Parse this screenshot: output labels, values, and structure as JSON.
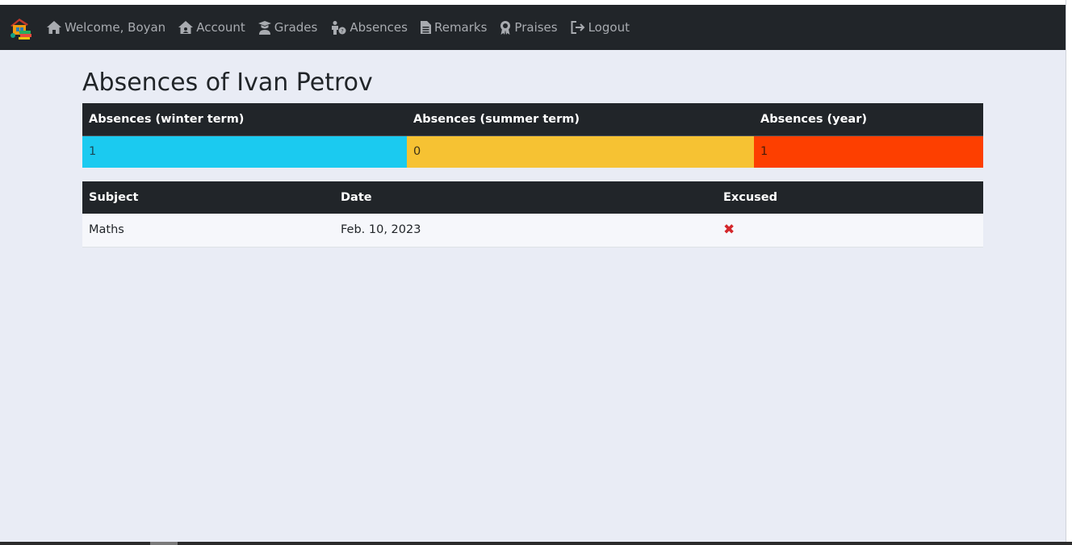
{
  "navbar": {
    "items": [
      {
        "icon": "home-icon",
        "label": "Welcome, Boyan"
      },
      {
        "icon": "account-house-icon",
        "label": "Account"
      },
      {
        "icon": "graduate-icon",
        "label": "Grades"
      },
      {
        "icon": "absent-person-icon",
        "label": "Absences"
      },
      {
        "icon": "document-icon",
        "label": "Remarks"
      },
      {
        "icon": "award-icon",
        "label": "Praises"
      },
      {
        "icon": "logout-icon",
        "label": "Logout"
      }
    ]
  },
  "page": {
    "title": "Absences of Ivan Petrov"
  },
  "summary": {
    "headers": [
      "Absences (winter term)",
      "Absences (summer term)",
      "Absences (year)"
    ],
    "values": [
      "1",
      "0",
      "1"
    ],
    "colors": {
      "winter": "#1bcaf0",
      "summer": "#f6c233",
      "year": "#fd3f00"
    }
  },
  "details": {
    "headers": [
      "Subject",
      "Date",
      "Excused"
    ],
    "rows": [
      {
        "subject": "Maths",
        "date": "Feb. 10, 2023",
        "excused": "✖"
      }
    ]
  }
}
